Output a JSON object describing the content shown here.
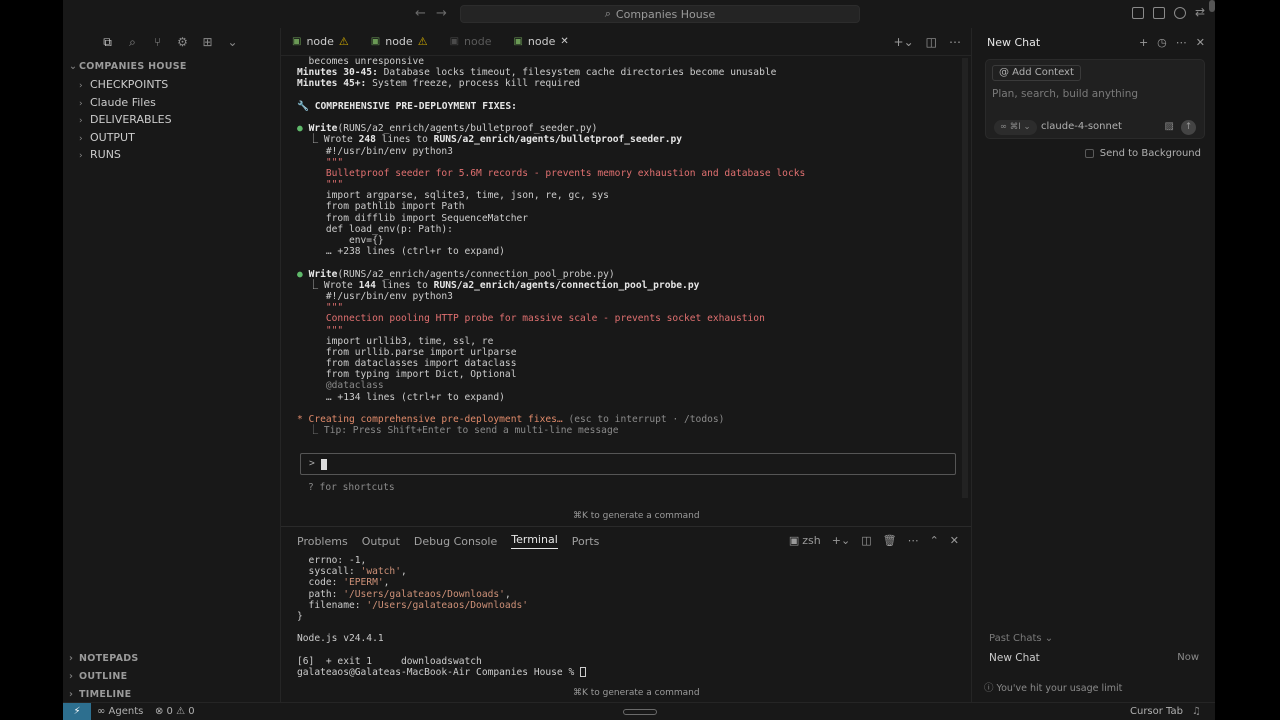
{
  "titlebar": {
    "back": "←",
    "forward": "→",
    "search_label": "Companies House"
  },
  "sidebar": {
    "section": "COMPANIES HOUSE",
    "items": [
      "CHECKPOINTS",
      "Claude Files",
      "DELIVERABLES",
      "OUTPUT",
      "RUNS"
    ],
    "bottom_sections": [
      "NOTEPADS",
      "OUTLINE",
      "TIMELINE"
    ]
  },
  "tabs": [
    {
      "label": "node",
      "warn": true,
      "dim": false
    },
    {
      "label": "node",
      "warn": true,
      "dim": false
    },
    {
      "label": "node",
      "warn": false,
      "dim": true
    },
    {
      "label": "node",
      "warn": false,
      "dim": false,
      "close": "✕"
    }
  ],
  "terminal": {
    "l0": "  becomes unresponsive",
    "l1_b": "Minutes 30-45:",
    "l1": " Database locks timeout, filesystem cache directories become unusable",
    "l2_b": "Minutes 45+:",
    "l2": " System freeze, process kill required",
    "l3": "🔧 COMPREHENSIVE PRE-DEPLOYMENT FIXES:",
    "w1_tool": "Write",
    "w1_path": "(RUNS/a2_enrich/agents/bulletproof_seeder.py)",
    "w1_a": "  ⎿ Wrote ",
    "w1_n": "248",
    "w1_b": " lines to ",
    "w1_file": "RUNS/a2_enrich/agents/bulletproof_seeder.py",
    "w1_c1": "     #!/usr/bin/env python3",
    "w1_c2": "     \"\"\"",
    "w1_c3": "     Bulletproof seeder for 5.6M records - prevents memory exhaustion and database locks",
    "w1_c4": "     \"\"\"",
    "w1_c5": "     import argparse, sqlite3, time, json, re, gc, sys",
    "w1_c6": "     from pathlib import Path",
    "w1_c7": "     from difflib import SequenceMatcher",
    "w1_c8": "     def load_env(p: Path):",
    "w1_c9": "         env={}",
    "w1_c10": "     … +238 lines (ctrl+r to expand)",
    "w2_tool": "Write",
    "w2_path": "(RUNS/a2_enrich/agents/connection_pool_probe.py)",
    "w2_a": "  ⎿ Wrote ",
    "w2_n": "144",
    "w2_b": " lines to ",
    "w2_file": "RUNS/a2_enrich/agents/connection_pool_probe.py",
    "w2_c1": "     #!/usr/bin/env python3",
    "w2_c2": "     \"\"\"",
    "w2_c3": "     Connection pooling HTTP probe for massive scale - prevents socket exhaustion",
    "w2_c4": "     \"\"\"",
    "w2_c5": "     import urllib3, time, ssl, re",
    "w2_c6": "     from urllib.parse import urlparse",
    "w2_c7": "     from dataclasses import dataclass",
    "w2_c8": "     from typing import Dict, Optional",
    "w2_c9": "     @dataclass",
    "w2_c10": "     … +134 lines (ctrl+r to expand)",
    "status_a": "* Creating comprehensive pre-deployment fixes…",
    "status_b": " (esc to interrupt · /todos)",
    "tip": "  ⎿ Tip: Press Shift+Enter to send a multi-line message",
    "prompt": ">",
    "shortcuts": "? for shortcuts",
    "hint": "⌘K to generate a command"
  },
  "panel": {
    "tabs": [
      "Problems",
      "Output",
      "Debug Console",
      "Terminal",
      "Ports"
    ],
    "active_tab": "Terminal",
    "shell": "zsh",
    "lines": {
      "p1": "  errno: -1,",
      "p2a": "  syscall: ",
      "p2b": "'watch'",
      "p3a": "  code: ",
      "p3b": "'EPERM'",
      "p4a": "  path: ",
      "p4b": "'/Users/galateaos/Downloads'",
      "p5a": "  filename: ",
      "p5b": "'/Users/galateaos/Downloads'",
      "p6": "}",
      "p7": "Node.js v24.4.1",
      "p8": "[6]  + exit 1     downloadswatch",
      "p9": "galateaos@Galateas-MacBook-Air Companies House % "
    },
    "hint": "⌘K to generate a command"
  },
  "chat": {
    "title": "New Chat",
    "add_context": "@ Add Context",
    "placeholder": "Plan, search, build anything",
    "mode": "∞ ⌘I ⌄",
    "model": "claude-4-sonnet",
    "send_background": "Send to Background",
    "past_chats": "Past Chats ⌄",
    "past_item": "New Chat",
    "past_when": "Now",
    "usage": "You've hit your usage limit"
  },
  "statusbar": {
    "remote": "⚡",
    "agents": "∞ Agents",
    "problems": "⊗ 0 ⚠ 0",
    "cursor_tab": "Cursor Tab",
    "bell": "🔔"
  }
}
